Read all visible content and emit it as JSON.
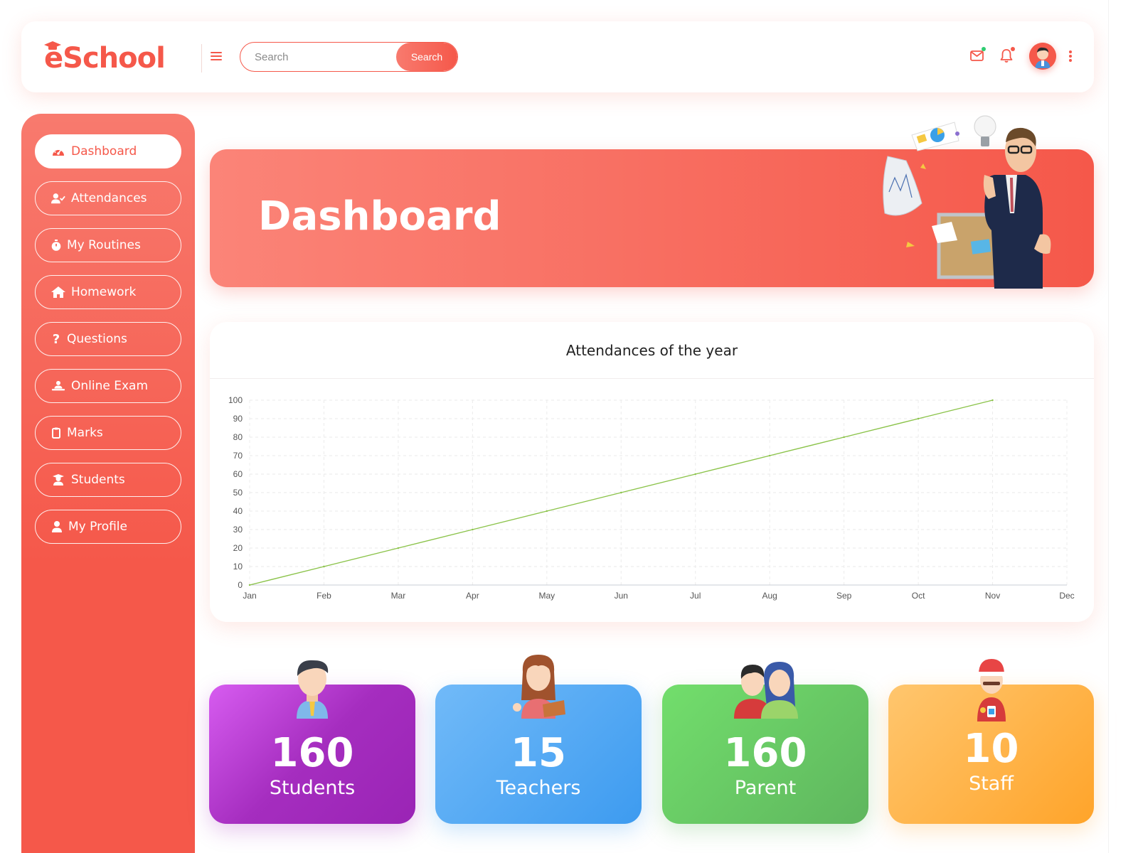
{
  "header": {
    "logo_text": "eSchool",
    "search_placeholder": "Search",
    "search_button": "Search"
  },
  "icons": {
    "mail": "envelope-icon",
    "notifications": "bell-icon",
    "more": "vertical-dots-icon",
    "menu": "hamburger-icon"
  },
  "colors": {
    "primary": "#f5584a",
    "primary_light": "#fb8478",
    "mail_dot": "#2ecc71",
    "bell_dot": "#f5584a",
    "chart_line": "#8bc34a"
  },
  "sidebar": {
    "items": [
      {
        "label": "Dashboard",
        "icon": "tachometer-icon",
        "active": true
      },
      {
        "label": "Attendances",
        "icon": "user-check-icon",
        "active": false
      },
      {
        "label": "My Routines",
        "icon": "stopwatch-icon",
        "active": false
      },
      {
        "label": "Homework",
        "icon": "home-icon",
        "active": false
      },
      {
        "label": "Questions",
        "icon": "question-icon",
        "active": false
      },
      {
        "label": "Online Exam",
        "icon": "chalkboard-user-icon",
        "active": false
      },
      {
        "label": "Marks",
        "icon": "clipboard-icon",
        "active": false
      },
      {
        "label": "Students",
        "icon": "graduate-icon",
        "active": false
      },
      {
        "label": "My Profile",
        "icon": "user-icon",
        "active": false
      }
    ]
  },
  "banner": {
    "title": "Dashboard"
  },
  "chart_data": {
    "type": "line",
    "title": "Attendances of the year",
    "xlabel": "",
    "ylabel": "",
    "categories": [
      "Jan",
      "Feb",
      "Mar",
      "Apr",
      "May",
      "Jun",
      "Jul",
      "Aug",
      "Sep",
      "Oct",
      "Nov",
      "Dec"
    ],
    "values": [
      0,
      10,
      20,
      30,
      40,
      50,
      60,
      70,
      80,
      90,
      100,
      null
    ],
    "ylim": [
      0,
      100
    ],
    "yticks": [
      0,
      10,
      20,
      30,
      40,
      50,
      60,
      70,
      80,
      90,
      100
    ],
    "grid": true,
    "legend": "none"
  },
  "stats": [
    {
      "value": "160",
      "label": "Students"
    },
    {
      "value": "15",
      "label": "Teachers"
    },
    {
      "value": "160",
      "label": "Parent"
    },
    {
      "value": "10",
      "label": "Staff"
    }
  ]
}
